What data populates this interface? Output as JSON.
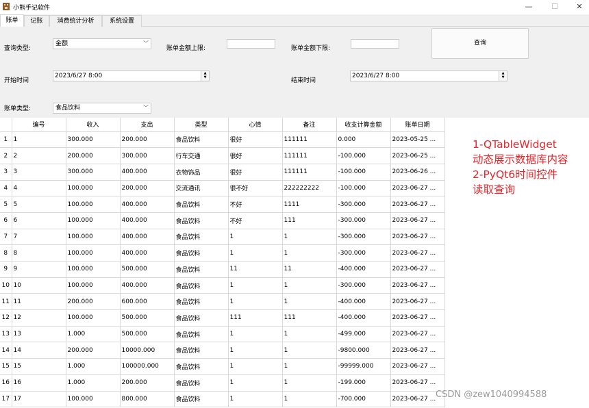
{
  "window": {
    "title": "小熊手记软件",
    "minimize": "—",
    "maximize": "☐",
    "close": "✕"
  },
  "tabs": [
    "账单",
    "记账",
    "消费统计分析",
    "系统设置"
  ],
  "form": {
    "query_type_label": "查询类型:",
    "query_type_value": "金额",
    "upper_label": "账单金额上限:",
    "lower_label": "账单金额下限:",
    "query_button": "查询",
    "start_label": "开始时间",
    "start_value": "2023/6/27 8:00",
    "end_label": "结束时间",
    "end_value": "2023/6/27 8:00",
    "bill_type_label": "账单类型:",
    "bill_type_value": "食品饮料"
  },
  "table": {
    "headers": [
      "编号",
      "收入",
      "支出",
      "类型",
      "心情",
      "备注",
      "收支计算金额",
      "账单日期"
    ],
    "rows": [
      [
        "1",
        "300.000",
        "200.000",
        "食品饮料",
        "很好",
        "111111",
        "0.000",
        "2023-05-25 ..."
      ],
      [
        "2",
        "200.000",
        "300.000",
        "行车交通",
        "很好",
        "111111",
        "-100.000",
        "2023-06-25 ..."
      ],
      [
        "3",
        "300.000",
        "400.000",
        "衣物饰品",
        "很好",
        "111111",
        "-100.000",
        "2023-06-26 ..."
      ],
      [
        "4",
        "100.000",
        "200.000",
        "交流通讯",
        "很不好",
        "222222222",
        "-100.000",
        "2023-06-27 ..."
      ],
      [
        "5",
        "100.000",
        "400.000",
        "食品饮料",
        "不好",
        "1111",
        "-300.000",
        "2023-06-27 ..."
      ],
      [
        "6",
        "100.000",
        "400.000",
        "食品饮料",
        "不好",
        "111",
        "-300.000",
        "2023-06-27 ..."
      ],
      [
        "7",
        "100.000",
        "400.000",
        "食品饮料",
        "1",
        "1",
        "-300.000",
        "2023-06-27 ..."
      ],
      [
        "8",
        "100.000",
        "400.000",
        "食品饮料",
        "1",
        "1",
        "-300.000",
        "2023-06-27 ..."
      ],
      [
        "9",
        "100.000",
        "500.000",
        "食品饮料",
        "11",
        "11",
        "-400.000",
        "2023-06-27 ..."
      ],
      [
        "10",
        "100.000",
        "400.000",
        "食品饮料",
        "1",
        "1",
        "-300.000",
        "2023-06-27 ..."
      ],
      [
        "11",
        "200.000",
        "600.000",
        "食品饮料",
        "1",
        "1",
        "-400.000",
        "2023-06-27 ..."
      ],
      [
        "12",
        "100.000",
        "500.000",
        "食品饮料",
        "111",
        "111",
        "-400.000",
        "2023-06-27 ..."
      ],
      [
        "13",
        "1.000",
        "500.000",
        "食品饮料",
        "1",
        "1",
        "-499.000",
        "2023-06-27 ..."
      ],
      [
        "14",
        "200.000",
        "10000.000",
        "食品饮料",
        "1",
        "1",
        "-9800.000",
        "2023-06-27 ..."
      ],
      [
        "15",
        "1.000",
        "100000.000",
        "食品饮料",
        "1",
        "1",
        "-99999.000",
        "2023-06-27 ..."
      ],
      [
        "16",
        "1.000",
        "200.000",
        "食品饮料",
        "1",
        "1",
        "-199.000",
        "2023-06-27 ..."
      ],
      [
        "17",
        "100.000",
        "800.000",
        "食品饮料",
        "1",
        "1",
        "-700.000",
        "2023-06-27 ..."
      ]
    ]
  },
  "annotation": [
    "1-QTableWidget",
    "动态展示数据库内容",
    "2-PyQt6时间控件",
    "读取查询"
  ],
  "watermark": "CSDN @zew1040994588",
  "colors": {
    "annotation": "#e8262b",
    "tab_bar": "#f0f0f0"
  }
}
